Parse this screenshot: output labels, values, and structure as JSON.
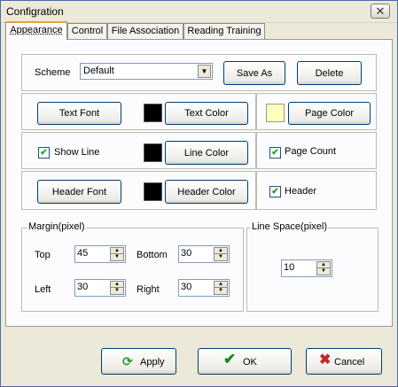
{
  "window": {
    "title": "Configration",
    "close_glyph": "✕"
  },
  "tabs": [
    {
      "label": "Appearance",
      "active": true
    },
    {
      "label": "Control",
      "active": false
    },
    {
      "label": "File Association",
      "active": false
    },
    {
      "label": "Reading Training",
      "active": false
    }
  ],
  "scheme": {
    "label": "Scheme",
    "value": "Default",
    "save_as": "Save As",
    "delete": "Delete"
  },
  "appearance": {
    "text_font": "Text Font",
    "text_color": "Text Color",
    "text_color_swatch": "#000000",
    "page_color": "Page Color",
    "page_color_swatch": "#ffffc0",
    "show_line": {
      "label": "Show Line",
      "checked": true
    },
    "line_color": "Line Color",
    "line_color_swatch": "#000000",
    "page_count": {
      "label": "Page Count",
      "checked": true
    },
    "header_font": "Header Font",
    "header_color": "Header Color",
    "header_color_swatch": "#000000",
    "header": {
      "label": "Header",
      "checked": true
    }
  },
  "margin": {
    "title": "Margin(pixel)",
    "top_label": "Top",
    "top_value": "45",
    "bottom_label": "Bottom",
    "bottom_value": "30",
    "left_label": "Left",
    "left_value": "30",
    "right_label": "Right",
    "right_value": "30"
  },
  "line_space": {
    "title": "Line Space(pixel)",
    "value": "10"
  },
  "footer": {
    "apply": "Apply",
    "apply_icon": "refresh-icon",
    "ok": "OK",
    "ok_icon": "checkmark-icon",
    "cancel": "Cancel",
    "cancel_icon": "x-icon"
  },
  "check_glyph": "✔",
  "spin_up_glyph": "▲",
  "spin_down_glyph": "▼",
  "dropdown_glyph": "▼"
}
